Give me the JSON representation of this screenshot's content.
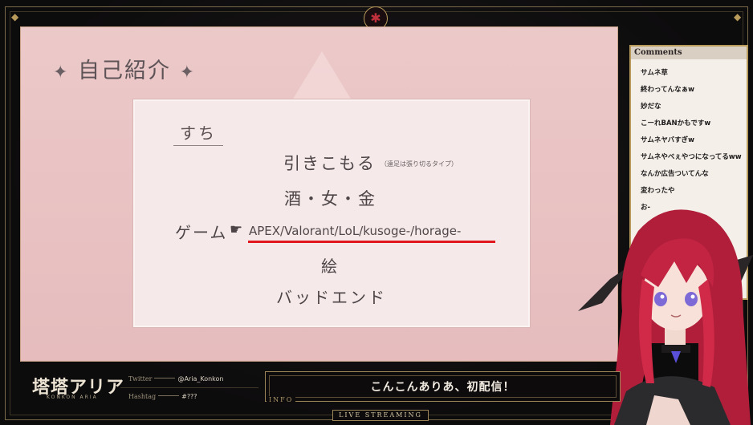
{
  "stream": {
    "emblem_glyph": "✱",
    "slide": {
      "title": "自己紹介",
      "title_sparkle": "✦",
      "card": {
        "heading": "すち",
        "lines": {
          "hikikomori": "引きこもる",
          "hikikomori_note": "（遠足は張り切るタイプ）",
          "sake": "酒・女・金",
          "game_label": "ゲーム",
          "game_pointer": "☛",
          "game_titles": "APEX/Valorant/LoL/kusoge-/horage-",
          "art": "絵",
          "bad_end": "バッドエンド"
        }
      }
    },
    "comments": {
      "header": "Comments",
      "items": [
        "サムネ草",
        "終わってんなぁw",
        "妙だな",
        "こーれBANかもですw",
        "サムネヤバすぎw",
        "サムネやべぇやつになってるww",
        "なんか広告ついてんな",
        "変わったや",
        "お-"
      ]
    },
    "footer": {
      "logo": "塔塔アリア",
      "logo_sub": "KONKON ARIA",
      "twitter_label": "Twitter",
      "twitter_value": "@Aria_Konkon",
      "hashtag_label": "Hashtag",
      "hashtag_value": "#???",
      "info_label": "INFO",
      "info_text": "こんこんありあ、初配信！",
      "live_label": "LIVE STREAMING"
    }
  },
  "colors": {
    "accent_gold": "#b89a5a",
    "underline_red": "#e0181e",
    "slide_pink": "#e8c2c3"
  }
}
